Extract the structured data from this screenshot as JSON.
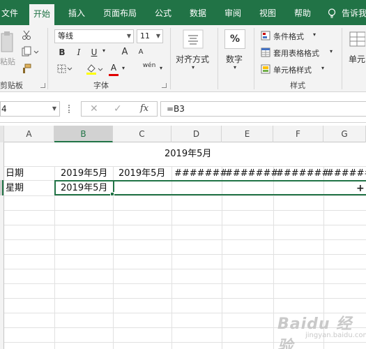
{
  "tabs": [
    "文件",
    "开始",
    "插入",
    "页面布局",
    "公式",
    "数据",
    "审阅",
    "视图",
    "帮助",
    "告诉我"
  ],
  "active_tab": "开始",
  "clipboard": {
    "paste_label": "粘贴",
    "group_label": "剪贴板"
  },
  "font": {
    "name": "等线",
    "size": "11",
    "bold": "B",
    "italic": "I",
    "underline": "U",
    "grow": "A",
    "shrink": "A",
    "font_color": "A",
    "wen": "wén",
    "group_label": "字体"
  },
  "alignment": {
    "label": "对齐方式"
  },
  "number": {
    "symbol": "%",
    "label": "数字"
  },
  "styles": {
    "conditional": "条件格式",
    "table": "套用表格格式",
    "cell": "单元格样式",
    "group_label": "样式"
  },
  "cells_group": {
    "label": "单元"
  },
  "formula_bar": {
    "name_box": "4",
    "cancel": "✕",
    "enter": "✓",
    "fx": "fx",
    "formula": "=B3"
  },
  "columns": [
    "A",
    "B",
    "C",
    "D",
    "E",
    "F",
    "G"
  ],
  "selected_column": "B",
  "cells": {
    "title": "2019年5月",
    "a2": "日期",
    "a3": "星期",
    "b2": "2019年5月",
    "c2": "2019年5月",
    "d2": "#######",
    "e2": "#######",
    "f2": "#######",
    "g2": "########",
    "b3": "2019年5月"
  },
  "watermark": {
    "brand": "Baidu 经验",
    "sub": "jingyan.baidu.com"
  },
  "colors": {
    "accent": "#217346",
    "ribbon_bg": "#f3f3f3"
  }
}
